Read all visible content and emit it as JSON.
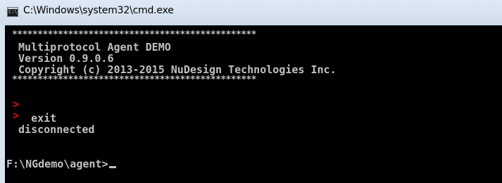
{
  "window": {
    "title": "C:\\Windows\\system32\\cmd.exe",
    "icon": "cmd-console-icon",
    "icon_text": "C:\\"
  },
  "console": {
    "lines": [
      "************************************************",
      " Multiprotocol Agent DEMO",
      " Version 0.9.0.6",
      " Copyright (c) 2013-2015 NuDesign Technologies Inc.",
      "************************************************",
      "",
      "   exit",
      " disconnected",
      "",
      "F:\\NGdemo\\agent>"
    ],
    "prompt_marker": ">",
    "colors": {
      "background": "#000000",
      "text": "#c0c0c0",
      "marker": "#e01010"
    }
  }
}
